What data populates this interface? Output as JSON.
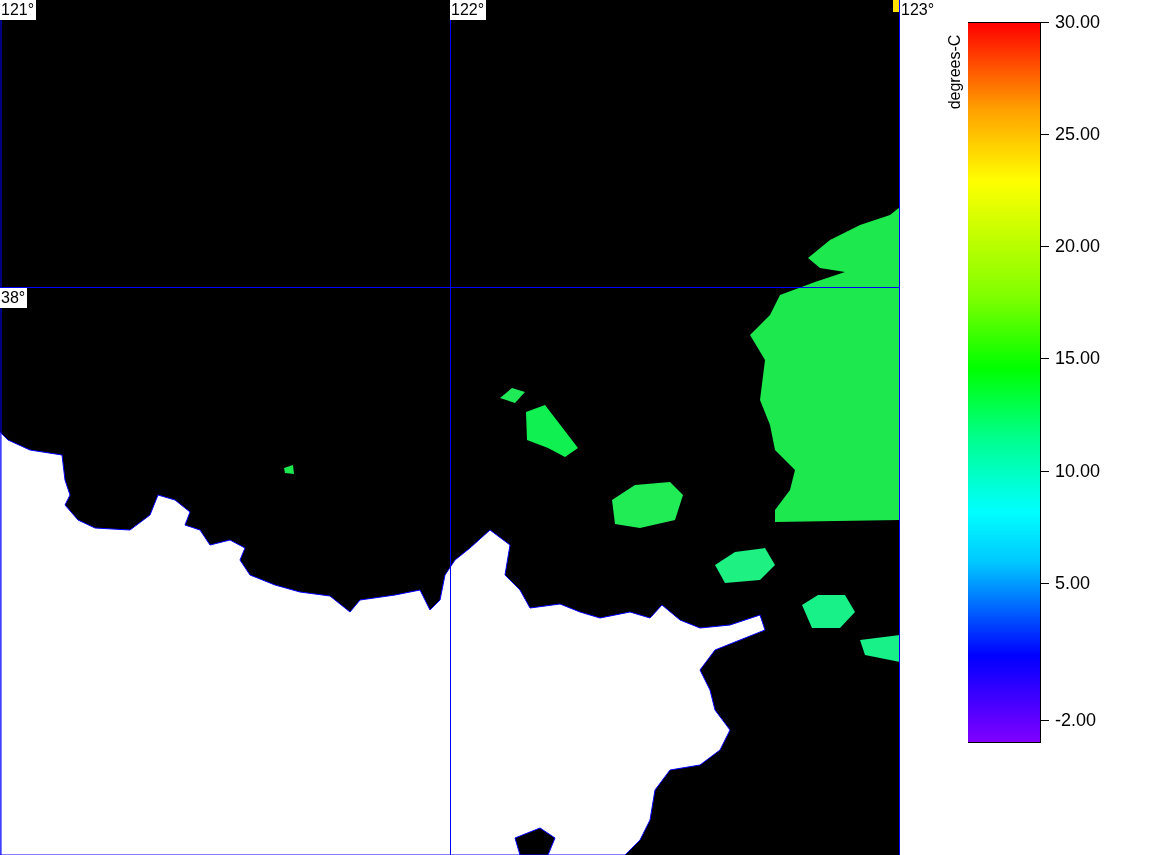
{
  "map": {
    "longitude_labels": [
      "121°",
      "122°",
      "123°"
    ],
    "latitude_labels": [
      "38°"
    ]
  },
  "legend": {
    "unit": "degrees-C",
    "ticks": [
      "30.00",
      "25.00",
      "20.00",
      "15.00",
      "10.00",
      "5.00",
      "-2.00"
    ]
  }
}
